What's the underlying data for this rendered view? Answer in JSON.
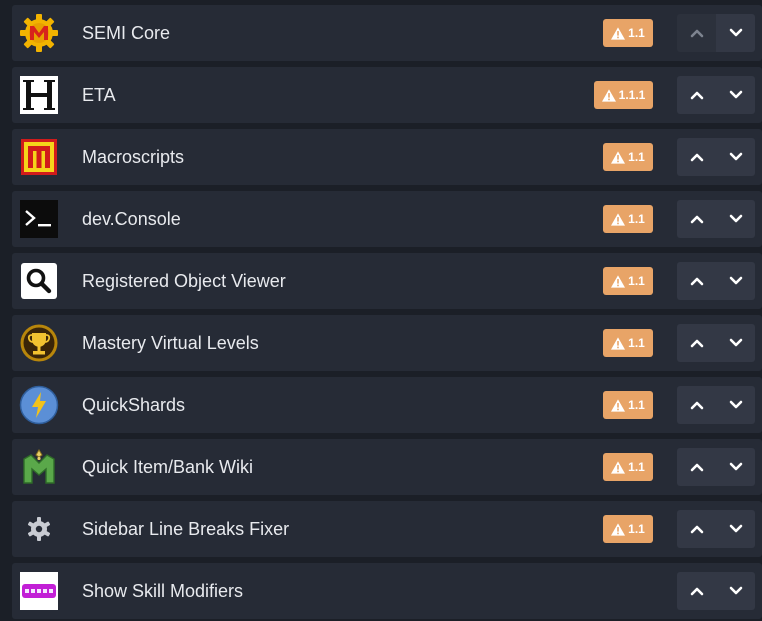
{
  "mods": [
    {
      "id": "semi-core",
      "name": "SEMI Core",
      "badge": "1.1",
      "icon": "semi-gear-icon",
      "up_disabled": true
    },
    {
      "id": "eta",
      "name": "ETA",
      "badge": "1.1.1",
      "icon": "eta-icon"
    },
    {
      "id": "macroscripts",
      "name": "Macroscripts",
      "badge": "1.1",
      "icon": "macroscripts-icon"
    },
    {
      "id": "dev-console",
      "name": "dev.Console",
      "badge": "1.1",
      "icon": "console-icon"
    },
    {
      "id": "registered-object-viewer",
      "name": "Registered Object Viewer",
      "badge": "1.1",
      "icon": "magnifier-icon"
    },
    {
      "id": "mastery-virtual-levels",
      "name": "Mastery Virtual Levels",
      "badge": "1.1",
      "icon": "trophy-icon"
    },
    {
      "id": "quickshards",
      "name": "QuickShards",
      "badge": "1.1",
      "icon": "lightning-icon"
    },
    {
      "id": "quick-item-bank-wiki",
      "name": "Quick Item/Bank Wiki",
      "badge": "1.1",
      "icon": "wiki-m-icon"
    },
    {
      "id": "sidebar-line-breaks-fixer",
      "name": "Sidebar Line Breaks Fixer",
      "badge": "1.1",
      "icon": "gear-icon"
    },
    {
      "id": "show-skill-modifiers",
      "name": "Show Skill Modifiers",
      "badge": "",
      "icon": "show-icon"
    }
  ],
  "colors": {
    "badge": "#e8a467",
    "row": "#262b36",
    "button": "#333845"
  },
  "icons": {
    "warning": "warning-triangle-icon",
    "move_up": "chevron-up-icon",
    "move_down": "chevron-down-icon"
  }
}
